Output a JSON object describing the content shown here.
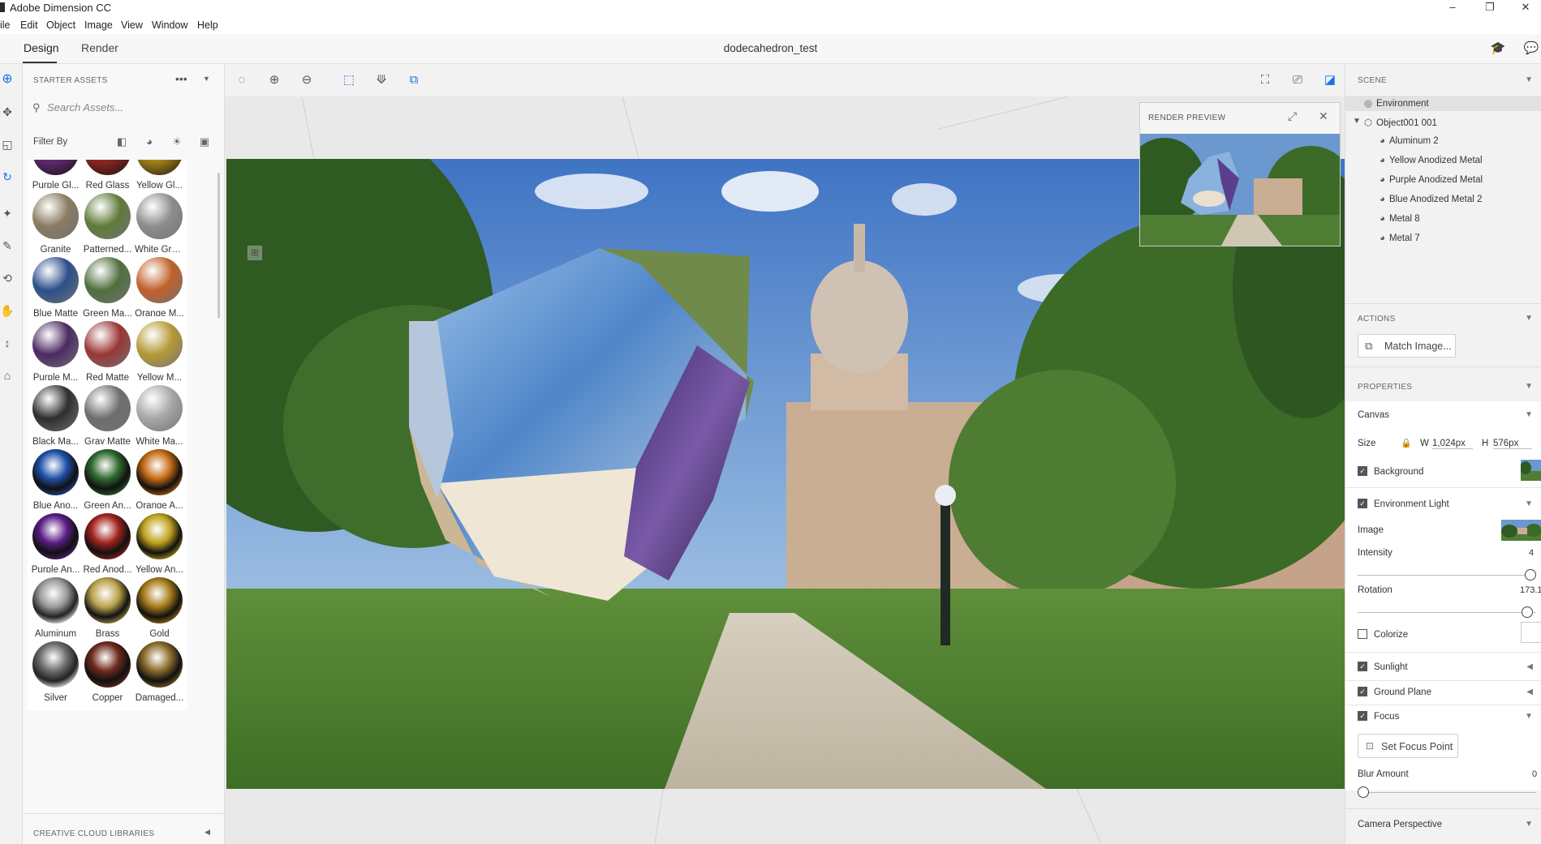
{
  "window": {
    "title": "Adobe Dimension CC",
    "controls": [
      "minimize-icon",
      "restore-icon",
      "close-icon"
    ]
  },
  "menu": [
    "ile",
    "Edit",
    "Object",
    "Image",
    "View",
    "Window",
    "Help"
  ],
  "tabs": [
    {
      "label": "Design",
      "active": true
    },
    {
      "label": "Render",
      "active": false
    }
  ],
  "document_title": "dodecahedron_test",
  "assets": {
    "header": "STARTER ASSETS",
    "search_placeholder": "Search Assets...",
    "filter_label": "Filter By",
    "materials": [
      {
        "label": "Purple Gl...",
        "color": "#6b2d7a",
        "kind": "glass"
      },
      {
        "label": "Red Glass",
        "color": "#9b2a22",
        "kind": "glass"
      },
      {
        "label": "Yellow Gl...",
        "color": "#b8901c",
        "kind": "glass"
      },
      {
        "label": "Granite",
        "color": "#8a7a62",
        "kind": "matte"
      },
      {
        "label": "Patterned...",
        "color": "#5f7a3a",
        "kind": "matte"
      },
      {
        "label": "White Gra...",
        "color": "#8d8d8d",
        "kind": "matte"
      },
      {
        "label": "Blue Matte",
        "color": "#2c4f8a",
        "kind": "matte"
      },
      {
        "label": "Green Ma...",
        "color": "#4f6f3e",
        "kind": "matte"
      },
      {
        "label": "Orange M...",
        "color": "#c0602a",
        "kind": "matte"
      },
      {
        "label": "Purple M...",
        "color": "#4c2a62",
        "kind": "matte"
      },
      {
        "label": "Red Matte",
        "color": "#9a3636",
        "kind": "matte"
      },
      {
        "label": "Yellow M...",
        "color": "#b49a36",
        "kind": "matte"
      },
      {
        "label": "Black Ma...",
        "color": "#2e2e2e",
        "kind": "matte"
      },
      {
        "label": "Gray Matte",
        "color": "#6e6e6e",
        "kind": "matte"
      },
      {
        "label": "White Ma...",
        "color": "#a6a6a6",
        "kind": "matte"
      },
      {
        "label": "Blue Ano...",
        "color": "#1f4fa8",
        "kind": "metal"
      },
      {
        "label": "Green An...",
        "color": "#2f6a2e",
        "kind": "metal"
      },
      {
        "label": "Orange A...",
        "color": "#c56a14",
        "kind": "metal"
      },
      {
        "label": "Purple An...",
        "color": "#5a1e86",
        "kind": "metal"
      },
      {
        "label": "Red Anod...",
        "color": "#a3221e",
        "kind": "metal"
      },
      {
        "label": "Yellow An...",
        "color": "#c0a21e",
        "kind": "metal"
      },
      {
        "label": "Aluminum",
        "color": "#9a9a9a",
        "kind": "chrome"
      },
      {
        "label": "Brass",
        "color": "#b9a24a",
        "kind": "metal"
      },
      {
        "label": "Gold",
        "color": "#a67a18",
        "kind": "metal"
      },
      {
        "label": "Silver",
        "color": "#6c6c6c",
        "kind": "chrome"
      },
      {
        "label": "Copper",
        "color": "#6e2a1c",
        "kind": "metal"
      },
      {
        "label": "Damaged...",
        "color": "#8a6a2a",
        "kind": "metal"
      }
    ],
    "footer": "CREATIVE CLOUD LIBRARIES"
  },
  "preview": {
    "title": "RENDER PREVIEW"
  },
  "scene": {
    "header": "SCENE",
    "items": [
      {
        "label": "Environment",
        "level": 0,
        "icon": "environment-icon"
      },
      {
        "label": "Object001 001",
        "level": 0,
        "icon": "cube-icon"
      },
      {
        "label": "Aluminum 2",
        "level": 1,
        "icon": "material-icon"
      },
      {
        "label": "Yellow Anodized Metal",
        "level": 1,
        "icon": "material-icon"
      },
      {
        "label": "Purple Anodized Metal",
        "level": 1,
        "icon": "material-icon"
      },
      {
        "label": "Blue Anodized Metal 2",
        "level": 1,
        "icon": "material-icon"
      },
      {
        "label": "Metal 8",
        "level": 1,
        "icon": "material-icon"
      },
      {
        "label": "Metal 7",
        "level": 1,
        "icon": "material-icon"
      }
    ]
  },
  "actions": {
    "header": "ACTIONS",
    "match_image": "Match Image..."
  },
  "properties": {
    "header": "PROPERTIES",
    "canvas": "Canvas",
    "size_label": "Size",
    "w_label": "W",
    "w_value": "1,024px",
    "h_label": "H",
    "h_value": "576px",
    "background": "Background",
    "environment_light": "Environment Light",
    "image": "Image",
    "intensity_label": "Intensity",
    "intensity_value": "4",
    "intensity_fraction": 1.0,
    "rotation_label": "Rotation",
    "rotation_value": "173.1",
    "rotation_fraction": 0.98,
    "colorize": "Colorize",
    "sunlight": "Sunlight",
    "ground_plane": "Ground Plane",
    "focus": "Focus",
    "set_focus_point": "Set Focus Point",
    "blur_label": "Blur Amount",
    "blur_value": "0",
    "blur_fraction": 0,
    "camera_perspective": "Camera Perspective"
  }
}
